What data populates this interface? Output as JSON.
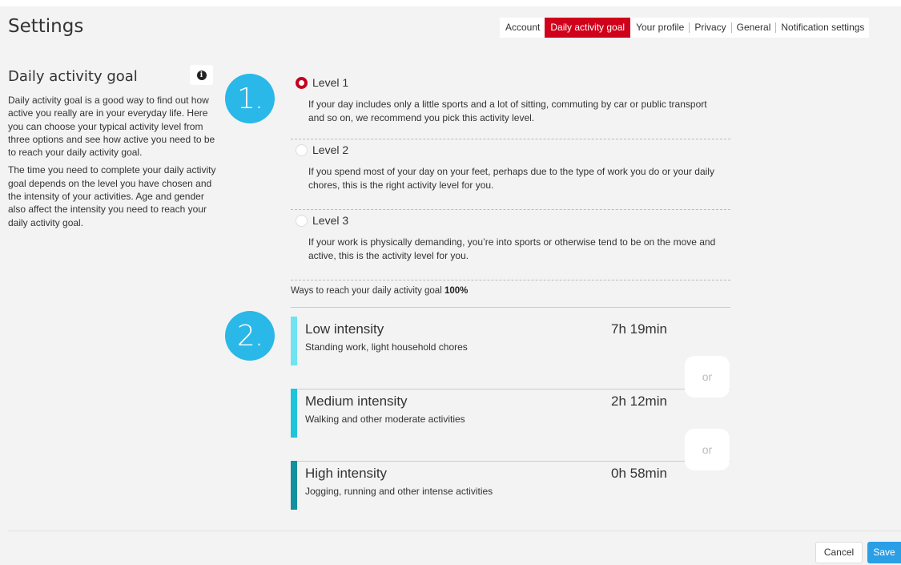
{
  "header": {
    "title": "Settings",
    "tabs": [
      {
        "label": "Account"
      },
      {
        "label": "Daily activity goal"
      },
      {
        "label": "Your profile"
      },
      {
        "label": "Privacy"
      },
      {
        "label": "General"
      },
      {
        "label": "Notification settings"
      }
    ],
    "active_tab": "Daily activity goal"
  },
  "sidebar": {
    "title": "Daily activity goal",
    "info_icon": "info-icon",
    "paragraphs": [
      "Daily activity goal is a good way to find out how active you really are in your everyday life. Here you can choose your typical activity level from three options and see how active you need to be to reach your daily activity goal.",
      "The time you need to complete your daily activity goal depends on the level you have chosen and the intensity of your activities. Age and gender also affect the intensity you need to reach your daily activity goal."
    ]
  },
  "steps": [
    "1.",
    "2."
  ],
  "levels": [
    {
      "label": "Level 1",
      "selected": true,
      "description": "If your day includes only a little sports and a lot of sitting, commuting by car or public transport and so on, we recommend you pick this activity level."
    },
    {
      "label": "Level 2",
      "selected": false,
      "description": "If you spend most of your day on your feet, perhaps due to the type of work you do or your daily chores, this is the right activity level for you."
    },
    {
      "label": "Level 3",
      "selected": false,
      "description": "If your work is physically demanding, you’re into sports or otherwise tend to be on the move and active, this is the activity level for you."
    }
  ],
  "ways": {
    "text": "Ways to reach your daily activity goal ",
    "percent": "100%"
  },
  "intensities": [
    {
      "name": "Low intensity",
      "description": "Standing work, light household chores",
      "time": "7h 19min",
      "color": "#6fe3f2"
    },
    {
      "name": "Medium intensity",
      "description": "Walking and other moderate activities",
      "time": "2h 12min",
      "color": "#1fc4da"
    },
    {
      "name": "High intensity",
      "description": "Jogging, running and other intense activities",
      "time": "0h 58min",
      "color": "#13909e"
    }
  ],
  "or_label": "or",
  "footer": {
    "cancel_label": "Cancel",
    "save_label": "Save"
  },
  "colors": {
    "accent_red": "#d0021b",
    "step_blue": "#2ab8e8",
    "save_blue": "#2b9fe6"
  }
}
